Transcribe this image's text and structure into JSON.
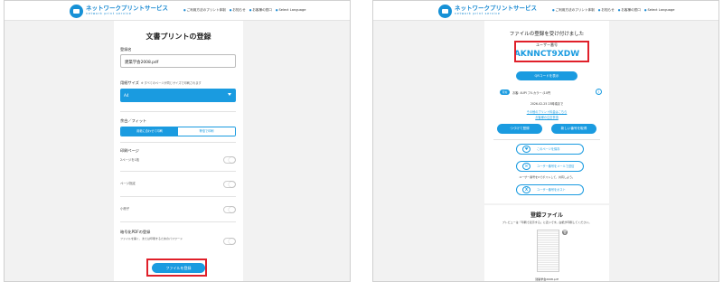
{
  "header": {
    "logo_text": "ネットワークプリントサービス",
    "logo_sub": "network print service",
    "nav": [
      "ご利用方法のプリント体制",
      "お知らせ",
      "お客様の窓口",
      "Select Language"
    ]
  },
  "left": {
    "title": "文書プリントの登録",
    "file_name_label": "登録名",
    "file_name_value": "建築学会2008.pdf",
    "paper_size_label": "用紙サイズ",
    "paper_size_hint": "※ すべてのページが同じサイズで印刷されます",
    "paper_size_value": "A4",
    "fit_label": "余白／フィット",
    "fit_options": [
      "用紙に合わせて印刷",
      "等倍で印刷"
    ],
    "print_pages_label": "印刷ページ",
    "print_pages_sub": "2ページを1枚",
    "page_spec_label": "ページ指定",
    "staple_label": "小冊子",
    "secure_label": "暗号化PDFの登録",
    "secure_sub": "ファイルを開く、または印刷するためのパスワード",
    "register_button": "ファイルを登録"
  },
  "right": {
    "received_title": "ファイルの登録を受け付けました",
    "user_number_label": "ユーザー番号",
    "user_number": "AKNNCT9XDW",
    "qr_button": "QRコードを表示",
    "badge": "有効",
    "validity_text": "お客: 4UPI フルカラー (10円",
    "expiry_text": "2026-02-25 23時頃まで",
    "link1": "その他のプリント料金はこちら",
    "link2": "お客様の注意事項",
    "continue_button": "つづけて登録",
    "new_number_button": "新しい番号を取得",
    "share_buttons": [
      "このページを保存",
      "ユーザー番号をメールで送信"
    ],
    "x_note": "ユーザー番号をXでポストして、共有しよう。",
    "x_button": "ユーザー番号をポスト",
    "reg_files_title": "登録ファイル",
    "reg_files_note": "プレビューは「印刷で表示する」に近いです。白紙が印刷してください。",
    "reg_file_name": "建築学会2008.pdf"
  }
}
